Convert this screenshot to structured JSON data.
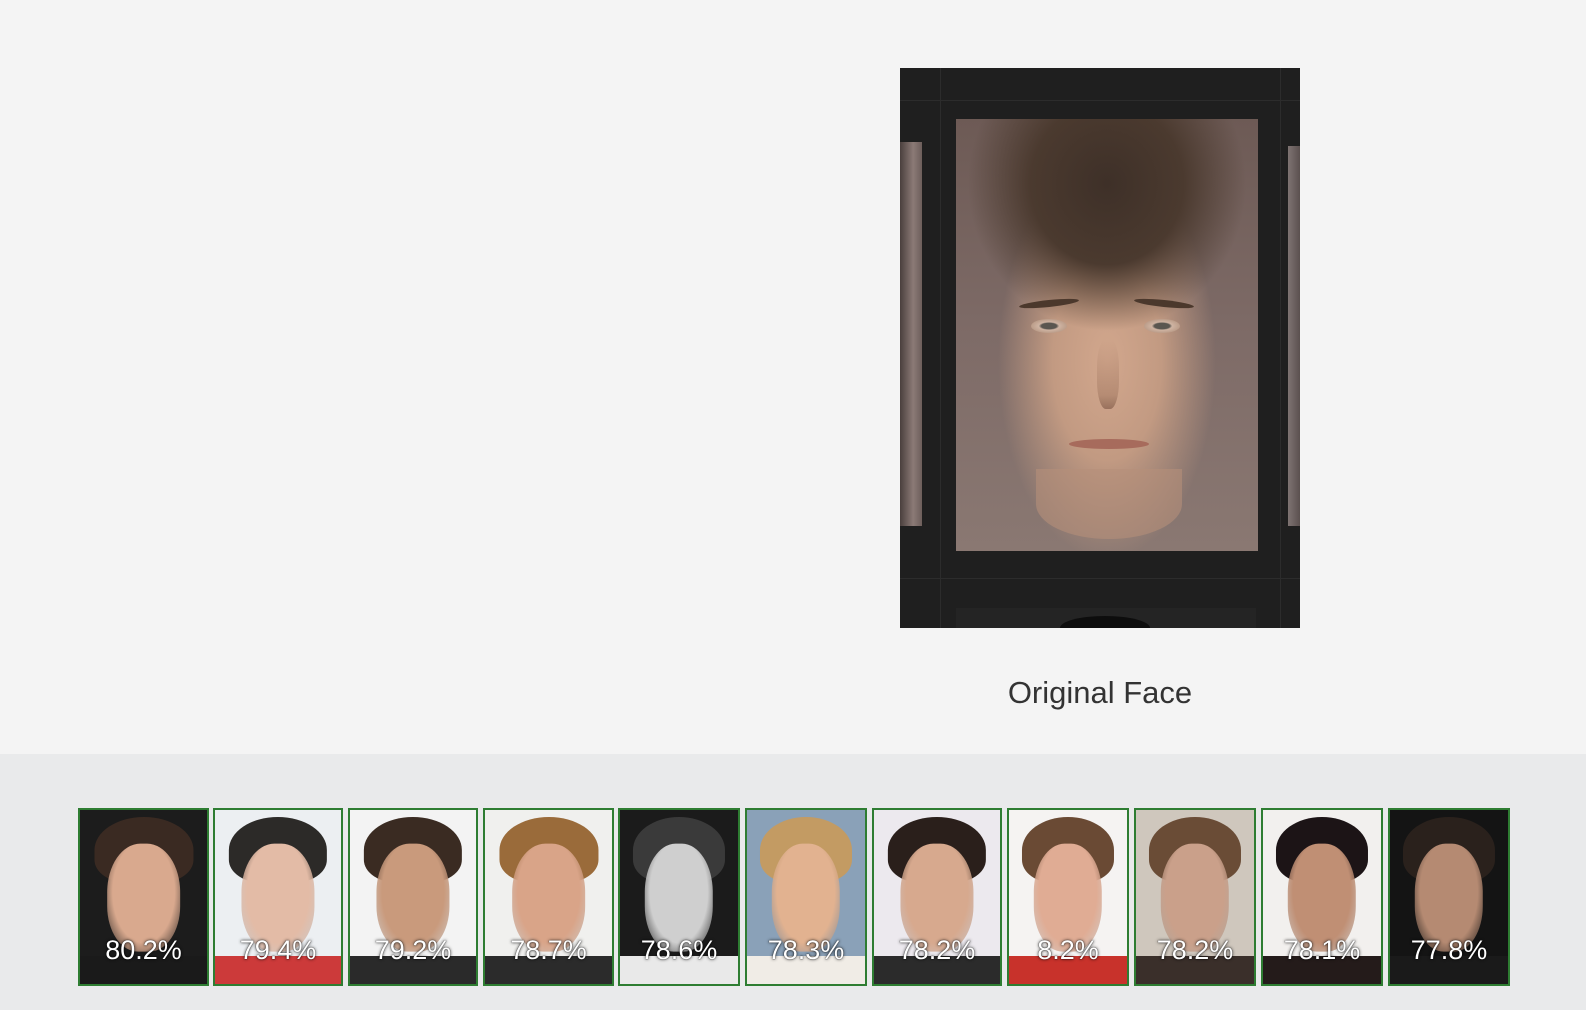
{
  "main": {
    "original_caption": "Original Face"
  },
  "results": [
    {
      "score": "80.2%",
      "bg": "#1c1c1c",
      "skin": "#d9a98e",
      "hair": "#3a2a22",
      "shirt": "#1a1a1a"
    },
    {
      "score": "79.4%",
      "bg": "#eceff2",
      "skin": "#e3bba6",
      "hair": "#2c2a28",
      "shirt": "#cc3a3a"
    },
    {
      "score": "79.2%",
      "bg": "#f3f3f3",
      "skin": "#c99a7c",
      "hair": "#3a2b22",
      "shirt": "#2a2a2a"
    },
    {
      "score": "78.7%",
      "bg": "#f0f0ee",
      "skin": "#d9a488",
      "hair": "#9a6b3a",
      "shirt": "#2b2b2b"
    },
    {
      "score": "78.6%",
      "bg": "#1b1b1b",
      "skin": "#cfcfcf",
      "hair": "#3a3a3a",
      "shirt": "#e9e9e9"
    },
    {
      "score": "78.3%",
      "bg": "#8aa1b8",
      "skin": "#e2b290",
      "hair": "#c39b63",
      "shirt": "#f0ece6"
    },
    {
      "score": "78.2%",
      "bg": "#ece9ee",
      "skin": "#d7a98e",
      "hair": "#2a1f1b",
      "shirt": "#2b2b2b"
    },
    {
      "score": "8.2%",
      "bg": "#f5f3f2",
      "skin": "#e0ac94",
      "hair": "#6a4a34",
      "shirt": "#c8322b"
    },
    {
      "score": "78.2%",
      "bg": "#cfc7bd",
      "skin": "#caa08a",
      "hair": "#6a4c36",
      "shirt": "#3a2f2a"
    },
    {
      "score": "78.1%",
      "bg": "#f2f0ee",
      "skin": "#c08f74",
      "hair": "#1c1416",
      "shirt": "#241b1a"
    },
    {
      "score": "77.8%",
      "bg": "#141414",
      "skin": "#b58a72",
      "hair": "#2a211c",
      "shirt": "#1a1a1a"
    }
  ]
}
